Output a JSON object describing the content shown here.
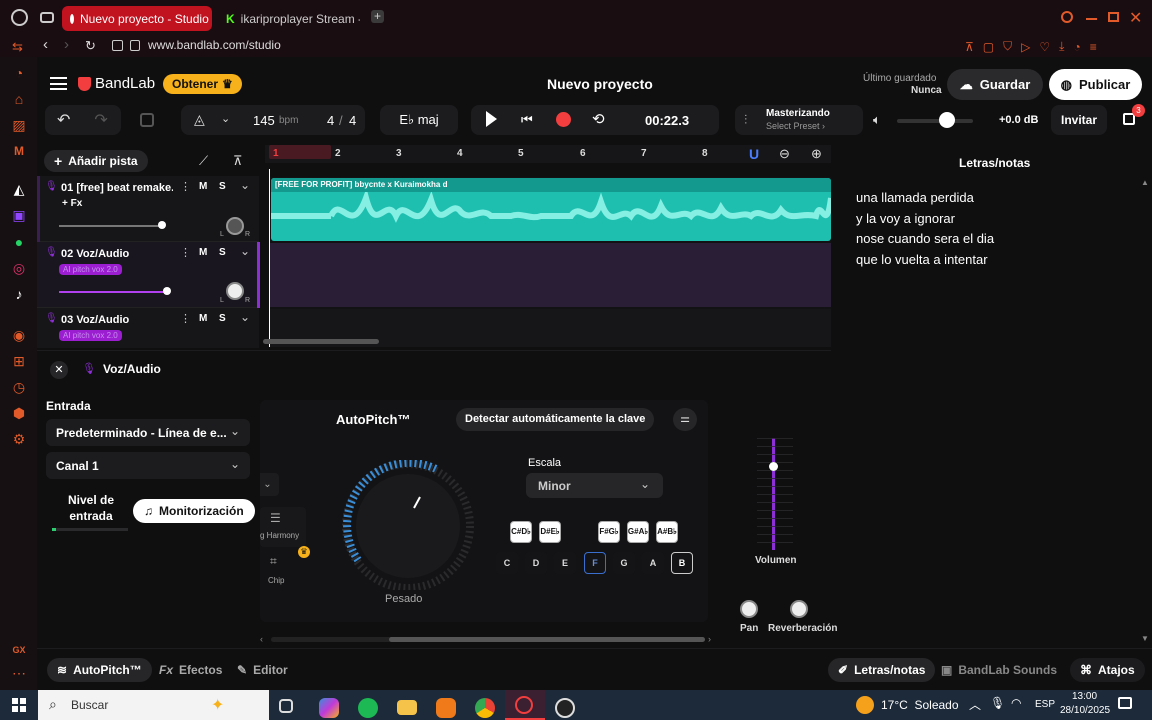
{
  "browser": {
    "tabs": [
      {
        "title": "Nuevo proyecto - Studio"
      },
      {
        "title": "ikariproplayer Stream - W"
      }
    ],
    "url": "www.bandlab.com/studio"
  },
  "header": {
    "brand": "BandLab",
    "obtener": "Obtener",
    "project_title": "Nuevo proyecto",
    "last_saved_label": "Último guardado",
    "last_saved_value": "Nunca",
    "save": "Guardar",
    "publish": "Publicar"
  },
  "toolbar": {
    "bpm_value": "145",
    "bpm_unit": "bpm",
    "time_sig_num": "4",
    "time_sig_sep": "/",
    "time_sig_den": "4",
    "key": "E♭ maj",
    "time": "00:22.3",
    "mastering_title": "Masterizando",
    "mastering_preset": "Select Preset ›",
    "volume_db": "+0.0 dB",
    "invite": "Invitar",
    "gift_count": "3"
  },
  "tracks": {
    "add_track": "Añadir pista",
    "fx": "+ Fx",
    "items": [
      {
        "num": "01",
        "name": "[free] beat remake...",
        "m": "M",
        "s": "S",
        "volume": 0.75
      },
      {
        "num": "02",
        "name": "Voz/Audio",
        "m": "M",
        "s": "S",
        "badge": "AI pitch vox 2.0",
        "volume": 0.82
      },
      {
        "num": "03",
        "name": "Voz/Audio",
        "m": "M",
        "s": "S",
        "badge": "AI pitch vox 2.0"
      }
    ],
    "pan_l": "L",
    "pan_r": "R"
  },
  "timeline": {
    "ruler": [
      "1",
      "2",
      "3",
      "4",
      "5",
      "6",
      "7",
      "8"
    ],
    "clip_title": "[FREE FOR PROFIT] bbycnte x Kuraimokha d"
  },
  "lyrics": {
    "title": "Letras/notas",
    "lines": [
      "una llamada perdida",
      "y la voy a ignorar",
      "nose cuando sera el dia",
      "que lo vuelta a intentar"
    ]
  },
  "panel": {
    "track_name": "Voz/Audio",
    "input_label": "Entrada",
    "input_device": "Predeterminado - Línea de e...",
    "channel": "Canal 1",
    "level_label_1": "Nivel de",
    "level_label_2": "entrada",
    "monitor": "Monitorización",
    "autopitch_title": "AutoPitch™",
    "detect_key": "Detectar automáticamente la clave",
    "weight_label": "Pesado",
    "scale_label": "Escala",
    "scale_value": "Minor",
    "black_keys": [
      {
        "top": "C#",
        "bot": "D♭"
      },
      {
        "top": "D#",
        "bot": "E♭"
      },
      {
        "top": "F#",
        "bot": "G♭"
      },
      {
        "top": "G#",
        "bot": "A♭"
      },
      {
        "top": "A#",
        "bot": "B♭"
      }
    ],
    "white_keys": [
      "C",
      "D",
      "E",
      "F",
      "G",
      "A",
      "B"
    ],
    "presets": [
      {
        "label": "g Harmony"
      },
      {
        "label": "Chip"
      }
    ],
    "volume_label": "Volumen",
    "pan_label": "Pan",
    "reverb_label": "Reverberación"
  },
  "bottom_tabs": {
    "autopitch": "AutoPitch™",
    "effects": "Efectos",
    "editor": "Editor",
    "lyrics": "Letras/notas",
    "sounds": "BandLab Sounds",
    "shortcuts": "Atajos"
  },
  "taskbar": {
    "search": "Buscar",
    "weather": "17°C  Soleado",
    "lang": "ESP",
    "time": "13:00",
    "date": "28/10/2025"
  },
  "colors": {
    "accent": "#f23e3e",
    "clip": "#1fbfb0",
    "purple": "#8d2fd6",
    "gold": "#f6b11b"
  }
}
